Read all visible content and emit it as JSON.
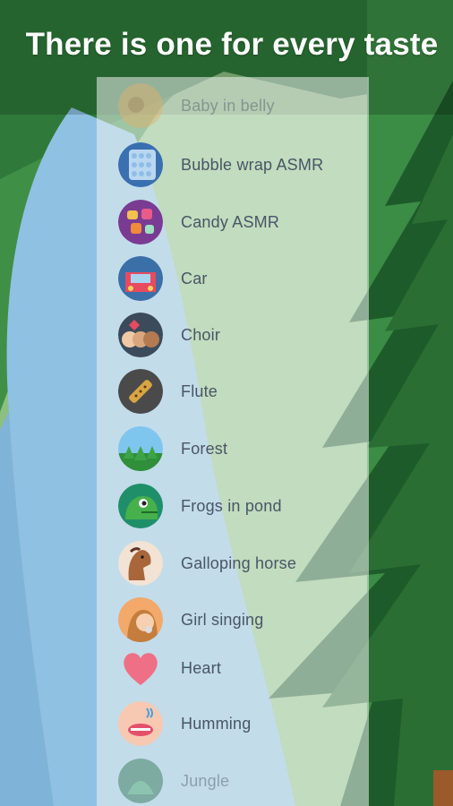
{
  "headline": "There is one for every taste",
  "sounds": [
    {
      "name": "Baby in belly",
      "icon": "baby-in-belly-icon"
    },
    {
      "name": "Bubble wrap ASMR",
      "icon": "bubble-wrap-icon"
    },
    {
      "name": "Candy ASMR",
      "icon": "candy-icon"
    },
    {
      "name": "Car",
      "icon": "car-icon"
    },
    {
      "name": "Choir",
      "icon": "choir-icon"
    },
    {
      "name": "Flute",
      "icon": "flute-icon"
    },
    {
      "name": "Forest",
      "icon": "forest-icon"
    },
    {
      "name": "Frogs in pond",
      "icon": "frog-icon"
    },
    {
      "name": "Galloping horse",
      "icon": "horse-icon"
    },
    {
      "name": "Girl singing",
      "icon": "girl-singing-icon"
    },
    {
      "name": "Heart",
      "icon": "heart-icon"
    },
    {
      "name": "Humming",
      "icon": "humming-icon"
    },
    {
      "name": "Jungle",
      "icon": "jungle-icon"
    }
  ],
  "colors": {
    "forest_dark": "#1f5f2c",
    "forest_mid": "#3e8f48",
    "river": "#8fc1e3",
    "headline_text": "#ffffff"
  }
}
